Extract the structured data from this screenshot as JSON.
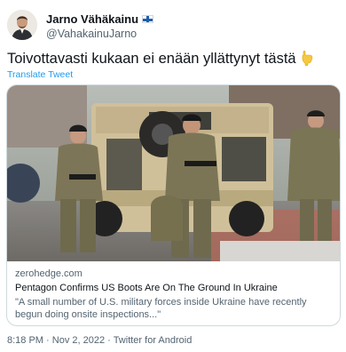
{
  "author": {
    "name": "Jarno Vähäkainu",
    "handle": "@VahakainuJarno"
  },
  "tweet": {
    "text": "Toivottavasti kukaan ei enään yllättynyt tästä",
    "emoji": "backhand-index-pointing-down",
    "translate_label": "Translate Tweet"
  },
  "card": {
    "domain": "zerohedge.com",
    "title": "Pentagon Confirms US Boots Are On The Ground In Ukraine",
    "description": "\"A small number of U.S. military forces inside Ukraine have recently begun doing onsite inspections...\""
  },
  "footer": {
    "time": "8:18 PM",
    "separator": "·",
    "date": "Nov 2, 2022",
    "source": "Twitter for Android"
  },
  "colors": {
    "link": "#1d9bf0",
    "secondary_text": "#536471",
    "border": "#cfd9de",
    "flag_blue": "#1e5fad"
  }
}
